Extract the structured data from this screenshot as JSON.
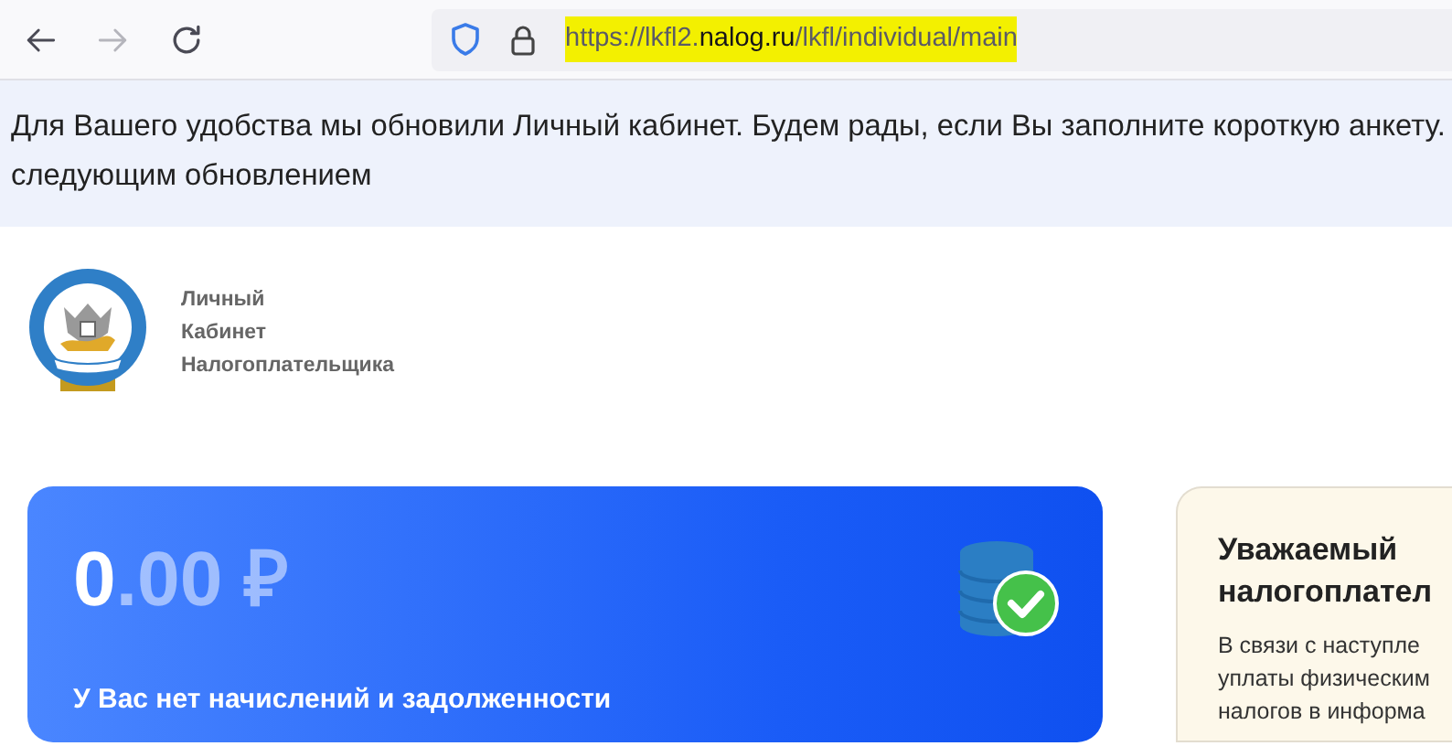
{
  "browser": {
    "nav_buttons": [
      {
        "kind": "back",
        "disabled": false
      },
      {
        "kind": "forward",
        "disabled": true
      },
      {
        "kind": "reload",
        "disabled": false
      }
    ],
    "address": {
      "highlighted": true,
      "parts": [
        {
          "text": "https://lkfl2.",
          "strong": false
        },
        {
          "text": "nalog.ru",
          "strong": true
        },
        {
          "text": "/lkfl/individual/main",
          "strong": false
        }
      ]
    }
  },
  "notice": {
    "lines": [
      "Для Вашего удобства мы обновили Личный кабинет. Будем рады, если Вы заполните короткую анкету.",
      "следующим обновлением"
    ]
  },
  "header": {
    "title_lines": [
      "Личный",
      "Кабинет",
      "Налогоплательщика"
    ]
  },
  "balance_card": {
    "amount_integer": "0",
    "amount_fraction": ".00",
    "currency": "₽",
    "status": "У Вас нет начислений и задолженности",
    "paid": true
  },
  "info_card": {
    "title_lines": [
      "Уважаемый",
      "налогоплател"
    ],
    "body_lines": [
      "В связи с наступле",
      "уплаты физическим",
      "налогов в информа"
    ]
  }
}
